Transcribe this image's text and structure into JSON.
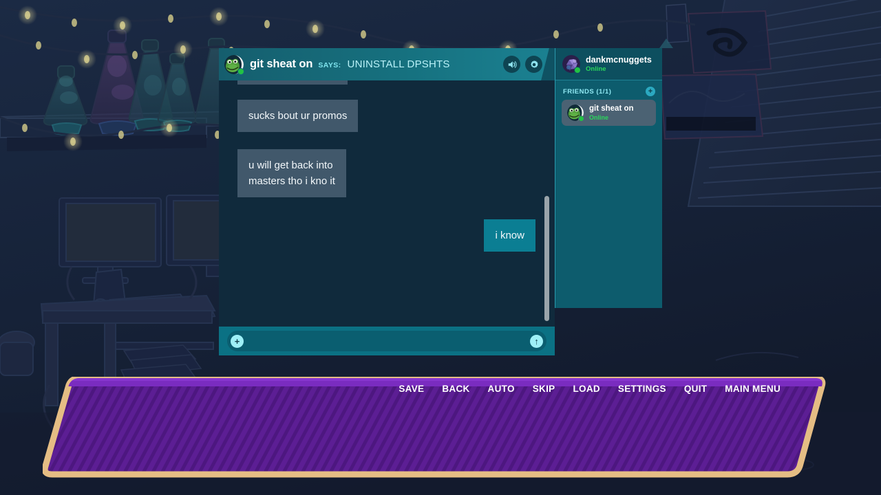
{
  "scene": {
    "description": "dark bedroom with desk, dual monitors, shelf of lava lamps, string lights, wall posters and window blinds"
  },
  "chat": {
    "header": {
      "avatar_icon": "frog-avatar-icon",
      "name": "git sheat on",
      "says_label": "SAYS:",
      "status_text": "UNINSTALL DPSHTS",
      "volume_icon": "speaker-icon",
      "settings_icon": "gear-icon"
    },
    "messages": [
      {
        "id": "m0",
        "direction": "incoming",
        "text": "",
        "clipped": true
      },
      {
        "id": "m1",
        "direction": "incoming",
        "text": "sucks bout ur promos",
        "clipped": false
      },
      {
        "id": "m2",
        "direction": "incoming",
        "text": "u will get back into\nmasters tho i kno it",
        "clipped": false
      },
      {
        "id": "m3",
        "direction": "outgoing",
        "text": "i know",
        "clipped": false
      }
    ],
    "composer": {
      "attach_label": "+",
      "send_label": "↑",
      "attach_icon": "plus-icon",
      "send_icon": "arrow-up-icon",
      "input_value": "",
      "placeholder": ""
    },
    "sidebar": {
      "me": {
        "avatar_icon": "crystal-avatar-icon",
        "name": "dankmcnuggets",
        "status": "Online"
      },
      "friends_header": "FRIENDS (1/1)",
      "add_friend_label": "+",
      "add_friend_icon": "plus-icon",
      "friends": [
        {
          "avatar_icon": "frog-avatar-icon",
          "name": "git sheat on",
          "status": "Online"
        }
      ]
    }
  },
  "dialogue": {
    "text": ""
  },
  "vn_menu": {
    "items": [
      {
        "label": "SAVE"
      },
      {
        "label": "BACK"
      },
      {
        "label": "AUTO"
      },
      {
        "label": "SKIP"
      },
      {
        "label": "LOAD"
      },
      {
        "label": "SETTINGS"
      },
      {
        "label": "QUIT"
      },
      {
        "label": "MAIN MENU"
      }
    ]
  },
  "colors": {
    "header_teal": "#16717f",
    "chat_bg": "#102a3c",
    "bubble_incoming": "#41586b",
    "bubble_outgoing": "#0b7e93",
    "sidebar_teal": "#0d5c6d",
    "online_green": "#2bd65c",
    "dialogue_purple": "#5c1e94",
    "dialogue_border_tan": "#e5bd84",
    "accent_cyan": "#7fe4ee"
  }
}
